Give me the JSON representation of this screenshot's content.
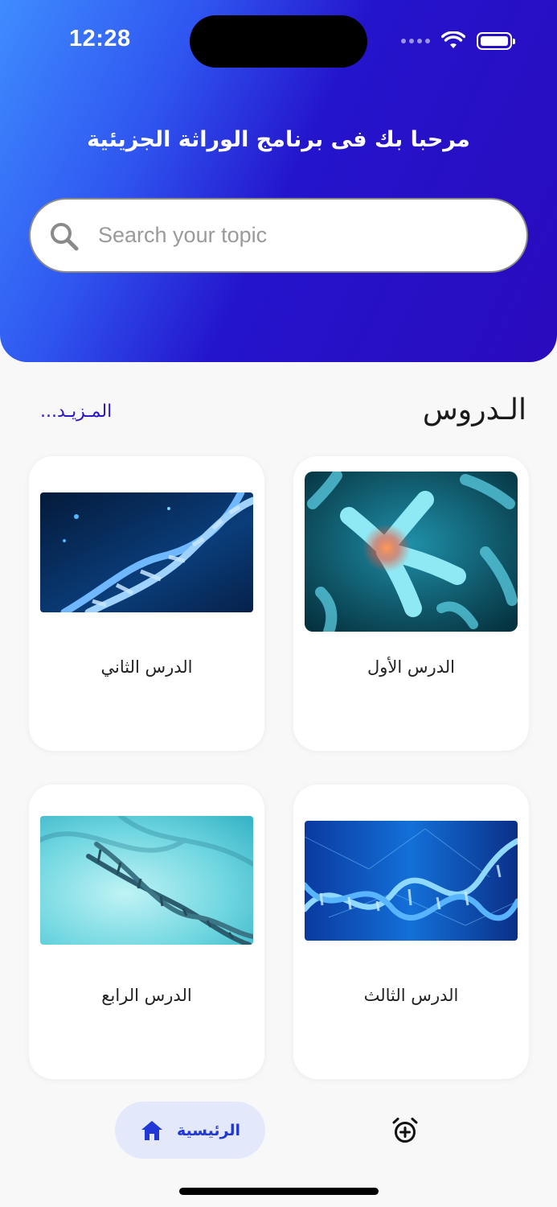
{
  "status_bar": {
    "time": "12:28"
  },
  "header": {
    "welcome_text": "مرحبا بك فى برنامج الوراثة الجزيئية"
  },
  "search": {
    "placeholder": "Search your topic",
    "value": ""
  },
  "section": {
    "title": "الـدروس",
    "more_link": "المـزيـد..."
  },
  "lessons": [
    {
      "label": "الدرس الأول",
      "image": "chromosome-image"
    },
    {
      "label": "الدرس الثاني",
      "image": "dna-helix-image"
    },
    {
      "label": "الدرس الثالث",
      "image": "dna-network-image"
    },
    {
      "label": "الدرس الرابع",
      "image": "dna-strand-image"
    }
  ],
  "bottom_nav": {
    "home_label": "الرئيسية",
    "home_icon": "home-icon",
    "alarm_icon": "alarm-add-icon"
  },
  "colors": {
    "header_gradient_start": "#3f8cff",
    "header_gradient_end": "#2a0bbd",
    "accent": "#2138d6",
    "link": "#2a17c4",
    "nav_pill": "#e3e9fb"
  }
}
